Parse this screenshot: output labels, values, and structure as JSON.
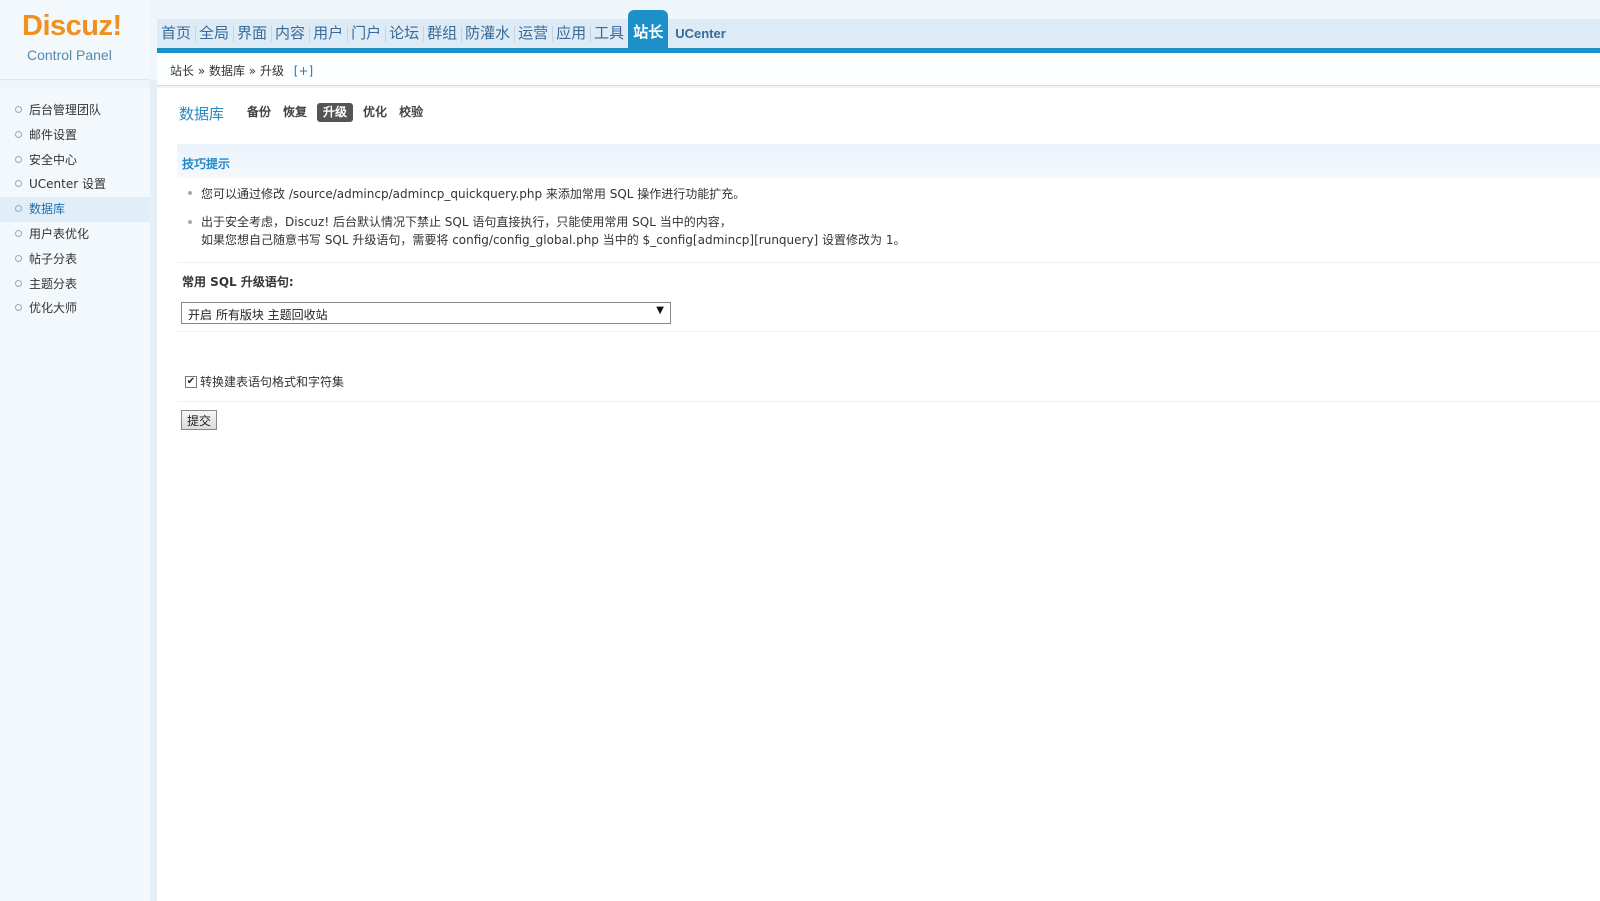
{
  "logo": {
    "brand": "Discuz!",
    "subtitle": "Control Panel"
  },
  "nav": {
    "items": [
      "首页",
      "全局",
      "界面",
      "内容",
      "用户",
      "门户",
      "论坛",
      "群组",
      "防灌水",
      "运营",
      "应用",
      "工具",
      "站长",
      "UCenter"
    ],
    "active": "站长"
  },
  "breadcrumb": {
    "path": "站长 » 数据库 » 升级",
    "plus": "[+]"
  },
  "sidebar": {
    "items": [
      "后台管理团队",
      "邮件设置",
      "安全中心",
      "UCenter 设置",
      "数据库",
      "用户表优化",
      "帖子分表",
      "主题分表",
      "优化大师"
    ],
    "active": "数据库"
  },
  "main": {
    "title": "数据库",
    "tabs": [
      "备份",
      "恢复",
      "升级",
      "优化",
      "校验"
    ],
    "active_tab": "升级",
    "tips": {
      "title": "技巧提示",
      "tip1": "您可以通过修改 /source/admincp/admincp_quickquery.php 来添加常用 SQL 操作进行功能扩充。",
      "tip2_line1": "出于安全考虑，Discuz! 后台默认情况下禁止 SQL 语句直接执行，只能使用常用 SQL 当中的内容，",
      "tip2_line2": "如果您想自己随意书写 SQL 升级语句，需要将 config/config_global.php 当中的 $_config[admincp][runquery] 设置修改为 1。"
    },
    "sql_label": "常用 SQL 升级语句:",
    "sql_selected": "开启 所有版块 主题回收站",
    "convert_checked": true,
    "convert_label": "转换建表语句格式和字符集",
    "submit_label": "提交"
  },
  "colors": {
    "accent": "#1e90c8",
    "logo": "#f0901e",
    "link": "#2589c7"
  }
}
